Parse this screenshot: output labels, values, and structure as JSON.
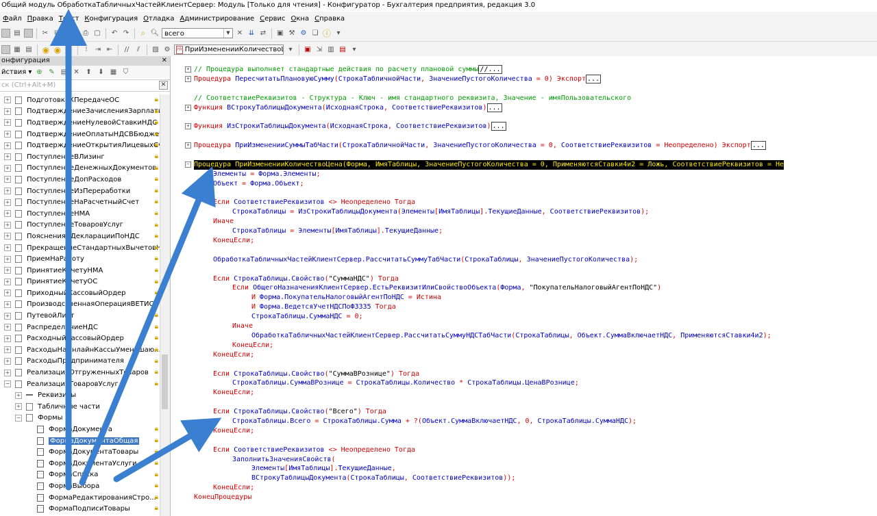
{
  "window": {
    "title": "Общий модуль ОбработкаТабличныхЧастейКлиентСервер: Модуль [Только для чтения] - Конфигуратор - Бухгалтерия предприятия, редакция 3.0"
  },
  "menu": [
    {
      "u": "Ф",
      "rest": "айл"
    },
    {
      "u": "П",
      "rest": "равка"
    },
    {
      "u": "Т",
      "rest": "екст"
    },
    {
      "u": "К",
      "rest": "онфигурация"
    },
    {
      "u": "О",
      "rest": "тладка"
    },
    {
      "u": "А",
      "rest": "дминистрирование"
    },
    {
      "u": "С",
      "rest": "ервис"
    },
    {
      "u": "О",
      "rest": "кна"
    },
    {
      "u": "С",
      "rest": "правка"
    }
  ],
  "toolbar": {
    "search_value": "всего",
    "procedure_value": "ПриИзмененииКоличествоЦена"
  },
  "left_panel": {
    "header": "онфигурация",
    "actions_label": "йствия",
    "search_placeholder": "ск (Ctrl+Alt+M)",
    "items": [
      {
        "label": "ПодготовкаКПередачеОС",
        "kind": "doc",
        "indent": 0,
        "lock": true
      },
      {
        "label": "ПодтверждениеЗачисленияЗарплаты",
        "kind": "doc",
        "indent": 0,
        "lock": true
      },
      {
        "label": "ПодтверждениеНулевойСтавкиНДС",
        "kind": "doc",
        "indent": 0,
        "lock": true
      },
      {
        "label": "ПодтверждениеОплатыНДСВБюджет",
        "kind": "doc",
        "indent": 0,
        "lock": true
      },
      {
        "label": "ПодтверждениеОткрытияЛицевыхСч...",
        "kind": "doc",
        "indent": 0,
        "lock": true
      },
      {
        "label": "ПоступлениеВЛизинг",
        "kind": "doc",
        "indent": 0,
        "lock": true
      },
      {
        "label": "ПоступлениеДенежныхДокументов",
        "kind": "doc",
        "indent": 0,
        "lock": true
      },
      {
        "label": "ПоступлениеДопРасходов",
        "kind": "doc",
        "indent": 0,
        "lock": true
      },
      {
        "label": "ПоступлениеИзПереработки",
        "kind": "doc",
        "indent": 0,
        "lock": true
      },
      {
        "label": "ПоступлениеНаРасчетныйСчет",
        "kind": "doc",
        "indent": 0,
        "lock": true
      },
      {
        "label": "ПоступлениеНМА",
        "kind": "doc",
        "indent": 0,
        "lock": true
      },
      {
        "label": "ПоступлениеТоваровУслуг",
        "kind": "doc",
        "indent": 0,
        "lock": true
      },
      {
        "label": "ПоясненияКДекларацииПоНДС",
        "kind": "doc",
        "indent": 0,
        "lock": true
      },
      {
        "label": "ПрекращениеСтандартныхВычетовН...",
        "kind": "doc",
        "indent": 0,
        "lock": true
      },
      {
        "label": "ПриемНаРаботу",
        "kind": "doc",
        "indent": 0,
        "lock": true
      },
      {
        "label": "ПринятиеКУчетуНМА",
        "kind": "doc",
        "indent": 0,
        "lock": true
      },
      {
        "label": "ПринятиеКУчетуОС",
        "kind": "doc",
        "indent": 0,
        "lock": true
      },
      {
        "label": "ПриходныйКассовыйОрдер",
        "kind": "doc",
        "indent": 0,
        "lock": true
      },
      {
        "label": "ПроизводственнаяОперацияВЕТИС",
        "kind": "doc",
        "indent": 0,
        "lock": true
      },
      {
        "label": "ПутевойЛист",
        "kind": "doc",
        "indent": 0,
        "lock": true
      },
      {
        "label": "РаспределениеНДС",
        "kind": "doc",
        "indent": 0,
        "lock": true
      },
      {
        "label": "РасходныйКассовыйОрдер",
        "kind": "doc",
        "indent": 0,
        "lock": true
      },
      {
        "label": "РасходыНаОнлайнКассыУменьшаю...",
        "kind": "doc",
        "indent": 0,
        "lock": true
      },
      {
        "label": "РасходыПредпринимателя",
        "kind": "doc",
        "indent": 0,
        "lock": true
      },
      {
        "label": "РеализацияОтгруженныхТоваров",
        "kind": "doc",
        "indent": 0,
        "lock": true
      },
      {
        "label": "РеализацияТоваровУслуг",
        "kind": "doc",
        "indent": 0,
        "lock": true,
        "expanded": true
      },
      {
        "label": "Реквизиты",
        "kind": "attr",
        "indent": 1,
        "lock": false
      },
      {
        "label": "Табличные части",
        "kind": "table",
        "indent": 1,
        "lock": false
      },
      {
        "label": "Формы",
        "kind": "forms",
        "indent": 1,
        "lock": false,
        "expanded": true
      },
      {
        "label": "ФормаДокумента",
        "kind": "form",
        "indent": 2,
        "lock": true
      },
      {
        "label": "ФормаДокументаОбщая",
        "kind": "form",
        "indent": 2,
        "lock": true,
        "selected": true
      },
      {
        "label": "ФормаДокументаТовары",
        "kind": "form",
        "indent": 2,
        "lock": true
      },
      {
        "label": "ФормаДокументаУслуги",
        "kind": "form",
        "indent": 2,
        "lock": true
      },
      {
        "label": "ФормаСписка",
        "kind": "form",
        "indent": 2,
        "lock": true
      },
      {
        "label": "ФормаВыбора",
        "kind": "form",
        "indent": 2,
        "lock": true
      },
      {
        "label": "ФормаРедактированияСтро...",
        "kind": "form",
        "indent": 2,
        "lock": true
      },
      {
        "label": "ФормаПодписиТовары",
        "kind": "form",
        "indent": 2,
        "lock": true
      }
    ]
  },
  "code_lines": [
    {
      "fold": "+",
      "parts": [
        [
          "cm",
          "// Процедура выполняет стандартные действия по расчету плановой суммы"
        ],
        [
          "box",
          "//..."
        ]
      ]
    },
    {
      "fold": "+",
      "parts": [
        [
          "kw",
          "Процедура "
        ],
        [
          "id",
          "ПересчитатьПлановуюСумму"
        ],
        [
          "kw",
          "("
        ],
        [
          "id",
          "СтрокаТабличнойЧасти"
        ],
        [
          "kw",
          ", "
        ],
        [
          "id",
          "ЗначениеПустогоКоличества"
        ],
        [
          "kw",
          " = 0) Экспорт"
        ],
        [
          "box",
          "..."
        ]
      ]
    },
    {
      "parts": []
    },
    {
      "fold": "",
      "parts": [
        [
          "cm",
          "// СоответствиеРеквизитов - Структура - Ключ - имя стандартного реквизита, Значение - имяПользовательского"
        ]
      ]
    },
    {
      "fold": "+",
      "parts": [
        [
          "kw",
          "Функция "
        ],
        [
          "id",
          "ВСтрокуТаблицыДокумента"
        ],
        [
          "kw",
          "("
        ],
        [
          "id",
          "ИсходнаяСтрока"
        ],
        [
          "kw",
          ", "
        ],
        [
          "id",
          "СоответствиеРеквизитов"
        ],
        [
          "kw",
          ")"
        ],
        [
          "box",
          "..."
        ]
      ]
    },
    {
      "parts": []
    },
    {
      "fold": "+",
      "parts": [
        [
          "kw",
          "Функция "
        ],
        [
          "id",
          "ИзСтрокиТаблицыДокумента"
        ],
        [
          "kw",
          "("
        ],
        [
          "id",
          "ИсходнаяСтрока"
        ],
        [
          "kw",
          ", "
        ],
        [
          "id",
          "СоответствиеРеквизитов"
        ],
        [
          "kw",
          ")"
        ],
        [
          "box",
          "..."
        ]
      ]
    },
    {
      "parts": []
    },
    {
      "fold": "+",
      "parts": [
        [
          "kw",
          "Процедура "
        ],
        [
          "id",
          "ПриИзмененииСуммыТабЧасти"
        ],
        [
          "kw",
          "("
        ],
        [
          "id",
          "СтрокаТабличнойЧасти"
        ],
        [
          "kw",
          ", "
        ],
        [
          "id",
          "ЗначениеПустогоКоличества"
        ],
        [
          "kw",
          " = 0, "
        ],
        [
          "id",
          "СоответствиеРеквизитов"
        ],
        [
          "kw",
          " = Неопределено) Экспорт"
        ],
        [
          "box",
          "..."
        ]
      ]
    },
    {
      "parts": []
    },
    {
      "fold": "-",
      "highlight": true,
      "parts": [
        [
          "kw",
          "Процедура "
        ],
        [
          "id",
          "ПриИзмененииКоличествоЦена"
        ],
        [
          "kw",
          "("
        ],
        [
          "id",
          "Форма"
        ],
        [
          "kw",
          ", "
        ],
        [
          "id",
          "ИмяТаблицы"
        ],
        [
          "kw",
          ", "
        ],
        [
          "id",
          "ЗначениеПустогоКоличества"
        ],
        [
          "kw",
          " = 0, "
        ],
        [
          "id",
          "ПрименяютсяСтавки4и2"
        ],
        [
          "kw",
          " = Ложь, "
        ],
        [
          "id",
          "СоответствиеРеквизитов"
        ],
        [
          "kw",
          " = Не"
        ]
      ]
    },
    {
      "indent": 1,
      "parts": [
        [
          "id",
          "Элементы"
        ],
        [
          "kw",
          " = "
        ],
        [
          "id",
          "Форма.Элементы"
        ],
        [
          "kw",
          ";"
        ]
      ]
    },
    {
      "indent": 1,
      "parts": [
        [
          "id",
          "Объект"
        ],
        [
          "kw",
          " = "
        ],
        [
          "id",
          "Форма.Объект"
        ],
        [
          "kw",
          ";"
        ]
      ]
    },
    {
      "parts": []
    },
    {
      "indent": 1,
      "parts": [
        [
          "kw",
          "Если "
        ],
        [
          "id",
          "СоответствиеРеквизитов"
        ],
        [
          "kw",
          " <> Неопределено Тогда"
        ]
      ]
    },
    {
      "indent": 2,
      "parts": [
        [
          "id",
          "СтрокаТаблицы"
        ],
        [
          "kw",
          " = "
        ],
        [
          "id",
          "ИзСтрокиТаблицыДокумента"
        ],
        [
          "kw",
          "("
        ],
        [
          "id",
          "Элементы"
        ],
        [
          "kw",
          "["
        ],
        [
          "id",
          "ИмяТаблицы"
        ],
        [
          "kw",
          "]."
        ],
        [
          "id",
          "ТекущиеДанные"
        ],
        [
          "kw",
          ", "
        ],
        [
          "id",
          "СоответствиеРеквизитов"
        ],
        [
          "kw",
          ");"
        ]
      ]
    },
    {
      "indent": 1,
      "parts": [
        [
          "kw",
          "Иначе"
        ]
      ]
    },
    {
      "indent": 2,
      "parts": [
        [
          "id",
          "СтрокаТаблицы"
        ],
        [
          "kw",
          " = "
        ],
        [
          "id",
          "Элементы"
        ],
        [
          "kw",
          "["
        ],
        [
          "id",
          "ИмяТаблицы"
        ],
        [
          "kw",
          "]."
        ],
        [
          "id",
          "ТекущиеДанные"
        ],
        [
          "kw",
          ";"
        ]
      ]
    },
    {
      "indent": 1,
      "parts": [
        [
          "kw",
          "КонецЕсли;"
        ]
      ]
    },
    {
      "parts": []
    },
    {
      "indent": 1,
      "parts": [
        [
          "id",
          "ОбработкаТабличныхЧастейКлиентСервер.РассчитатьСуммуТабЧасти"
        ],
        [
          "kw",
          "("
        ],
        [
          "id",
          "СтрокаТаблицы"
        ],
        [
          "kw",
          ", "
        ],
        [
          "id",
          "ЗначениеПустогоКоличества"
        ],
        [
          "kw",
          ");"
        ]
      ]
    },
    {
      "parts": []
    },
    {
      "indent": 1,
      "parts": [
        [
          "kw",
          "Если "
        ],
        [
          "id",
          "СтрокаТаблицы.Свойство"
        ],
        [
          "kw",
          "("
        ],
        [
          "st",
          "\"СуммаНДС\""
        ],
        [
          "kw",
          ") Тогда"
        ]
      ]
    },
    {
      "indent": 2,
      "parts": [
        [
          "kw",
          "Если "
        ],
        [
          "id",
          "ОбщегоНазначенияКлиентСервер.ЕстьРеквизитИлиСвойствоОбъекта"
        ],
        [
          "kw",
          "("
        ],
        [
          "id",
          "Форма"
        ],
        [
          "kw",
          ", "
        ],
        [
          "st",
          "\"ПокупательНалоговыйАгентПоНДС\""
        ],
        [
          "kw",
          ")"
        ]
      ]
    },
    {
      "indent": 3,
      "parts": [
        [
          "kw",
          "И "
        ],
        [
          "id",
          "Форма.ПокупательНалоговыйАгентПоНДС"
        ],
        [
          "kw",
          " = Истина"
        ]
      ]
    },
    {
      "indent": 3,
      "parts": [
        [
          "kw",
          "И "
        ],
        [
          "id",
          "Форма.ВедетсяУчетНДСПоФЗ335"
        ],
        [
          "kw",
          " Тогда"
        ]
      ]
    },
    {
      "indent": 3,
      "parts": [
        [
          "id",
          "СтрокаТаблицы.СуммаНДС"
        ],
        [
          "kw",
          " = 0;"
        ]
      ]
    },
    {
      "indent": 2,
      "parts": [
        [
          "kw",
          "Иначе"
        ]
      ]
    },
    {
      "indent": 3,
      "parts": [
        [
          "id",
          "ОбработкаТабличныхЧастейКлиентСервер.РассчитатьСуммуНДСТабЧасти"
        ],
        [
          "kw",
          "("
        ],
        [
          "id",
          "СтрокаТаблицы"
        ],
        [
          "kw",
          ", "
        ],
        [
          "id",
          "Объект.СуммаВключаетНДС"
        ],
        [
          "kw",
          ", "
        ],
        [
          "id",
          "ПрименяютсяСтавки4и2"
        ],
        [
          "kw",
          ");"
        ]
      ]
    },
    {
      "indent": 2,
      "parts": [
        [
          "kw",
          "КонецЕсли;"
        ]
      ]
    },
    {
      "indent": 1,
      "parts": [
        [
          "kw",
          "КонецЕсли;"
        ]
      ]
    },
    {
      "parts": []
    },
    {
      "indent": 1,
      "parts": [
        [
          "kw",
          "Если "
        ],
        [
          "id",
          "СтрокаТаблицы.Свойство"
        ],
        [
          "kw",
          "("
        ],
        [
          "st",
          "\"СуммаВРознице\""
        ],
        [
          "kw",
          ") Тогда"
        ]
      ]
    },
    {
      "indent": 2,
      "parts": [
        [
          "id",
          "СтрокаТаблицы.СуммаВРознице"
        ],
        [
          "kw",
          " = "
        ],
        [
          "id",
          "СтрокаТаблицы.Количество"
        ],
        [
          "kw",
          " * "
        ],
        [
          "id",
          "СтрокаТаблицы.ЦенаВРознице"
        ],
        [
          "kw",
          ";"
        ]
      ]
    },
    {
      "indent": 1,
      "parts": [
        [
          "kw",
          "КонецЕсли;"
        ]
      ]
    },
    {
      "parts": []
    },
    {
      "indent": 1,
      "parts": [
        [
          "kw",
          "Если "
        ],
        [
          "id",
          "СтрокаТаблицы.Свойство"
        ],
        [
          "kw",
          "("
        ],
        [
          "st",
          "\"Всего\""
        ],
        [
          "kw",
          ") Тогда"
        ]
      ]
    },
    {
      "indent": 2,
      "parts": [
        [
          "id",
          "СтрокаТаблицы.Всего"
        ],
        [
          "kw",
          " = "
        ],
        [
          "id",
          "СтрокаТаблицы.Сумма"
        ],
        [
          "kw",
          " + ?("
        ],
        [
          "id",
          "Объект.СуммаВключаетНДС"
        ],
        [
          "kw",
          ", 0, "
        ],
        [
          "id",
          "СтрокаТаблицы.СуммаНДС"
        ],
        [
          "kw",
          ");"
        ]
      ]
    },
    {
      "indent": 1,
      "parts": [
        [
          "kw",
          "КонецЕсли;"
        ]
      ]
    },
    {
      "parts": []
    },
    {
      "indent": 1,
      "parts": [
        [
          "kw",
          "Если "
        ],
        [
          "id",
          "СоответствиеРеквизитов"
        ],
        [
          "kw",
          " <> Неопределено Тогда"
        ]
      ]
    },
    {
      "indent": 2,
      "parts": [
        [
          "id",
          "ЗаполнитьЗначенияСвойств"
        ],
        [
          "kw",
          "("
        ]
      ]
    },
    {
      "indent": 3,
      "parts": [
        [
          "id",
          "Элементы"
        ],
        [
          "kw",
          "["
        ],
        [
          "id",
          "ИмяТаблицы"
        ],
        [
          "kw",
          "]."
        ],
        [
          "id",
          "ТекущиеДанные"
        ],
        [
          "kw",
          ","
        ]
      ]
    },
    {
      "indent": 3,
      "parts": [
        [
          "id",
          "ВСтрокуТаблицыДокумента"
        ],
        [
          "kw",
          "("
        ],
        [
          "id",
          "СтрокаТаблицы"
        ],
        [
          "kw",
          ", "
        ],
        [
          "id",
          "СоответствиеРеквизитов"
        ],
        [
          "kw",
          "));"
        ]
      ]
    },
    {
      "indent": 1,
      "parts": [
        [
          "kw",
          "КонецЕсли;"
        ]
      ]
    },
    {
      "parts": [
        [
          "kw",
          "КонецПроцедуры"
        ]
      ]
    }
  ],
  "colors": {
    "keyword": "#d00000",
    "comment": "#009a00",
    "identifier": "#0000c8",
    "arrow": "#3a7fd0",
    "selection": "#3c78c3"
  }
}
